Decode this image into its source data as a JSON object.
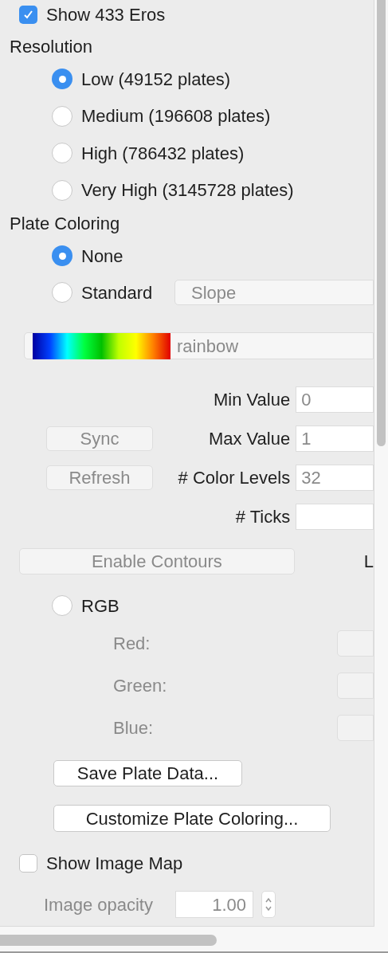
{
  "show_eros": {
    "label": "Show 433 Eros",
    "checked": true
  },
  "resolution": {
    "title": "Resolution",
    "options": [
      {
        "label": "Low (49152 plates)",
        "selected": true
      },
      {
        "label": "Medium (196608 plates)",
        "selected": false
      },
      {
        "label": "High (786432 plates)",
        "selected": false
      },
      {
        "label": "Very High (3145728 plates)",
        "selected": false
      }
    ]
  },
  "plate_coloring": {
    "title": "Plate Coloring",
    "options": [
      {
        "label": "None",
        "selected": true
      },
      {
        "label": "Standard",
        "selected": false,
        "dropdown": "Slope"
      }
    ]
  },
  "colormap": {
    "name": "rainbow"
  },
  "value_rows": [
    {
      "label": "Min Value",
      "value": "0"
    },
    {
      "button": {
        "label": "Sync",
        "disabled": true
      },
      "label": "Max Value",
      "value": "1"
    },
    {
      "button": {
        "label": "Refresh",
        "disabled": true
      },
      "label": "# Color Levels",
      "value": "32"
    },
    {
      "label": "# Ticks"
    }
  ],
  "contours_button": {
    "label": "Enable Contours",
    "disabled": true
  },
  "cut_label": "L",
  "rgb": {
    "label": "RGB",
    "selected": false,
    "channels": [
      {
        "label": "Red:"
      },
      {
        "label": "Green:"
      },
      {
        "label": "Blue:"
      }
    ]
  },
  "save_button": {
    "label": "Save Plate Data...",
    "disabled": false
  },
  "customize_button": {
    "label": "Customize Plate Coloring...",
    "disabled": false
  },
  "show_image_map": {
    "label": "Show Image Map",
    "checked": false
  },
  "image_opacity": {
    "label": "Image opacity",
    "value": "1.00",
    "disabled": true
  }
}
